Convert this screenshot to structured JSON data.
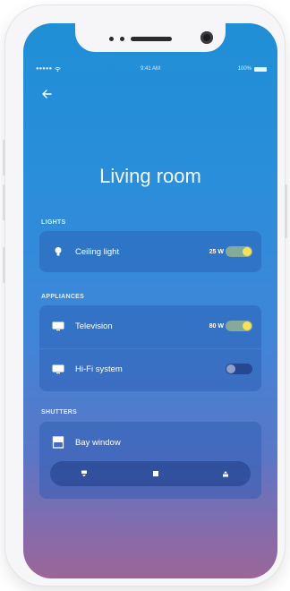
{
  "status_bar": {
    "signal": "●●●●● ",
    "time": "9:41 AM",
    "battery_label": "100%"
  },
  "page": {
    "title": "Living room"
  },
  "sections": {
    "lights": {
      "label": "LIGHTS",
      "items": [
        {
          "name": "Ceiling light",
          "power": "25 W",
          "on": true,
          "icon": "bulb-icon"
        }
      ]
    },
    "appliances": {
      "label": "APPLIANCES",
      "items": [
        {
          "name": "Television",
          "power": "80 W",
          "on": true,
          "icon": "tv-icon"
        },
        {
          "name": "Hi-Fi system",
          "power": "",
          "on": false,
          "icon": "monitor-icon"
        }
      ]
    },
    "shutters": {
      "label": "SHUTTERS",
      "items": [
        {
          "name": "Bay window",
          "icon": "window-icon"
        }
      ],
      "controls": [
        "shutter-down-icon",
        "shutter-stop-icon",
        "shutter-up-icon"
      ]
    }
  },
  "colors": {
    "toggle_on": "#f3e25a",
    "gradient_top": "#1f8fd6",
    "gradient_bottom": "#9a6698"
  }
}
